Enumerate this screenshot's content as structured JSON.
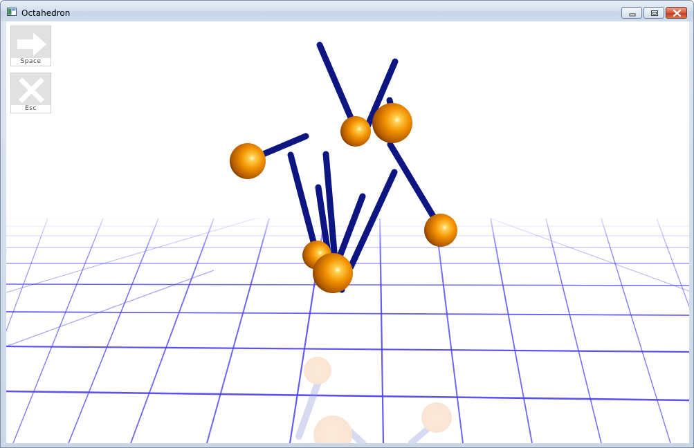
{
  "window": {
    "title": "Octahedron"
  },
  "controls": {
    "space": {
      "label": "Space",
      "icon": "arrow-right-icon"
    },
    "esc": {
      "label": "Esc",
      "icon": "close-x-icon"
    }
  },
  "colors": {
    "rod": "#0d1580",
    "ball": "#f08a00",
    "grid": "#4b3ff0",
    "background": "#ffffff"
  }
}
